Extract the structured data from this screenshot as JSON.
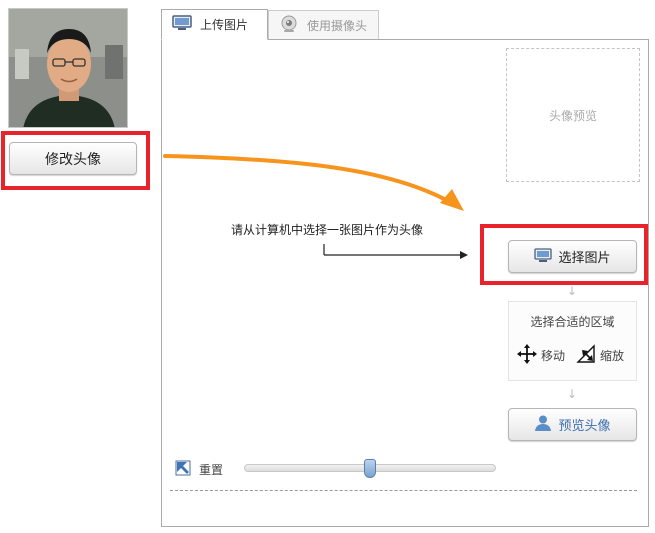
{
  "avatar": {
    "alt": "用户头像",
    "edit_button": "修改头像"
  },
  "tabs": [
    {
      "label": "上传图片",
      "icon": "monitor-icon",
      "active": true
    },
    {
      "label": "使用摄像头",
      "icon": "webcam-icon",
      "active": false
    }
  ],
  "preview": {
    "label": "头像预览"
  },
  "upload": {
    "hint": "请从计算机中选择一张图片作为头像",
    "select_button": "选择图片"
  },
  "area": {
    "title": "选择合适的区域",
    "move_label": "移动",
    "zoom_label": "缩放"
  },
  "preview_button": "预览头像",
  "reset_label": "重置",
  "zoom_slider": {
    "value": 0.5
  },
  "colors": {
    "annotation_red": "#e8232b",
    "annotation_orange": "#f7941d",
    "accent_blue": "#5b8dc9"
  }
}
